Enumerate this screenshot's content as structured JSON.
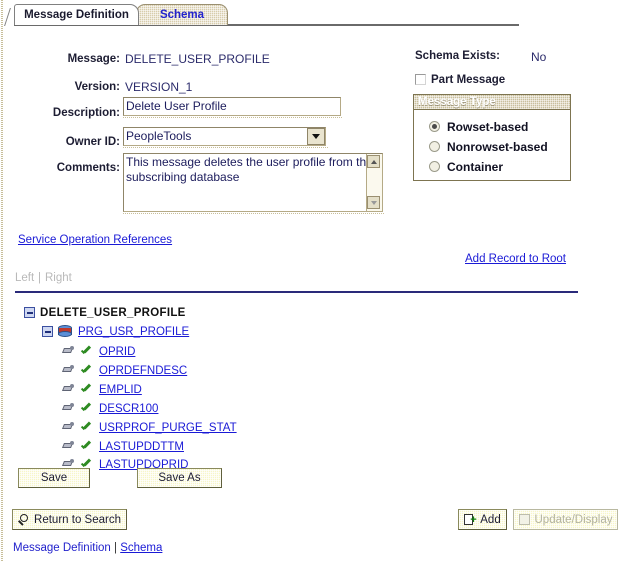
{
  "tabs": [
    {
      "label": "Message Definition",
      "active": true
    },
    {
      "label": "Schema",
      "active": false
    }
  ],
  "form": {
    "message_label": "Message:",
    "message_value": "DELETE_USER_PROFILE",
    "version_label": "Version:",
    "version_value": "VERSION_1",
    "description_label": "Description:",
    "description_value": "Delete User Profile",
    "owner_label": "Owner ID:",
    "owner_value": "PeopleTools",
    "comments_label": "Comments:",
    "comments_value": "This message deletes the user profile from the subscribing database"
  },
  "right": {
    "schema_exists_label": "Schema Exists:",
    "schema_exists_value": "No",
    "part_message_label": "Part Message",
    "part_message_checked": false,
    "message_type_title": "Message Type",
    "message_type_options": [
      {
        "label": "Rowset-based",
        "selected": true
      },
      {
        "label": "Nonrowset-based",
        "selected": false
      },
      {
        "label": "Container",
        "selected": false
      }
    ]
  },
  "links": {
    "service_operation_references": "Service Operation References",
    "add_record_to_root": "Add Record to Root",
    "left": "Left",
    "separator": "|",
    "right": "Right"
  },
  "tree": {
    "root": {
      "label": "DELETE_USER_PROFILE",
      "expanded": true
    },
    "record": {
      "label": "PRG_USR_PROFILE",
      "expanded": true
    },
    "fields": [
      {
        "label": "OPRID",
        "included": true
      },
      {
        "label": "OPRDEFNDESC",
        "included": true
      },
      {
        "label": "EMPLID",
        "included": true
      },
      {
        "label": "DESCR100",
        "included": true
      },
      {
        "label": "USRPROF_PURGE_STAT",
        "included": true
      },
      {
        "label": "LASTUPDDTTM",
        "included": true
      },
      {
        "label": "LASTUPDOPRID",
        "included": true
      }
    ]
  },
  "buttons": {
    "save": "Save",
    "save_as": "Save As",
    "return_to_search": "Return to Search",
    "add": "Add",
    "update_display": "Update/Display",
    "update_display_disabled": true
  },
  "footer": {
    "current_page": "Message Definition",
    "separator": "|",
    "link": "Schema"
  },
  "colors": {
    "link": "#1a1ad6",
    "tab_inactive": "#d7ccab",
    "button": "#f7f6c8",
    "rule": "#2a2a7a",
    "group_border": "#7d7450"
  }
}
